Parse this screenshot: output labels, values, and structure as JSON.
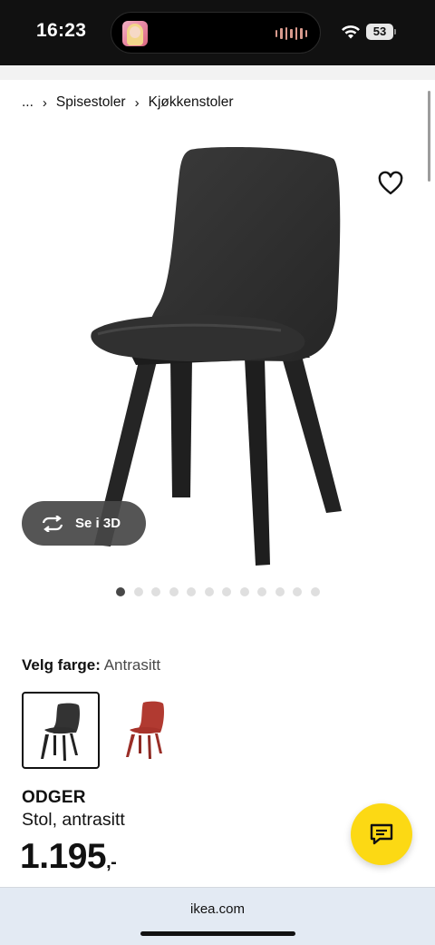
{
  "status_bar": {
    "time": "16:23",
    "battery": "53",
    "icons": [
      "wifi-icon",
      "battery-icon"
    ]
  },
  "breadcrumb": {
    "ellipsis": "...",
    "items": [
      "Spisestoler",
      "Kjøkkenstoler"
    ]
  },
  "product": {
    "image_icon": "chair-image",
    "view_3d_label": "Se i 3D",
    "carousel": {
      "count": 12,
      "active_index": 0
    },
    "color_heading_label": "Velg farge:",
    "color_selected": "Antrasitt",
    "color_swatches": [
      {
        "name": "antrasitt",
        "color": "#2f2f2f",
        "selected": true
      },
      {
        "name": "red",
        "color": "#a8332b",
        "selected": false
      }
    ],
    "name": "ODGER",
    "description": "Stol, antrasitt",
    "price": "1.195",
    "price_suffix": ",-"
  },
  "browser": {
    "url": "ikea.com"
  },
  "colors": {
    "accent_yellow": "#fcd914",
    "status_bar_bg": "#111111",
    "url_bar_bg": "#e3eaf3"
  }
}
